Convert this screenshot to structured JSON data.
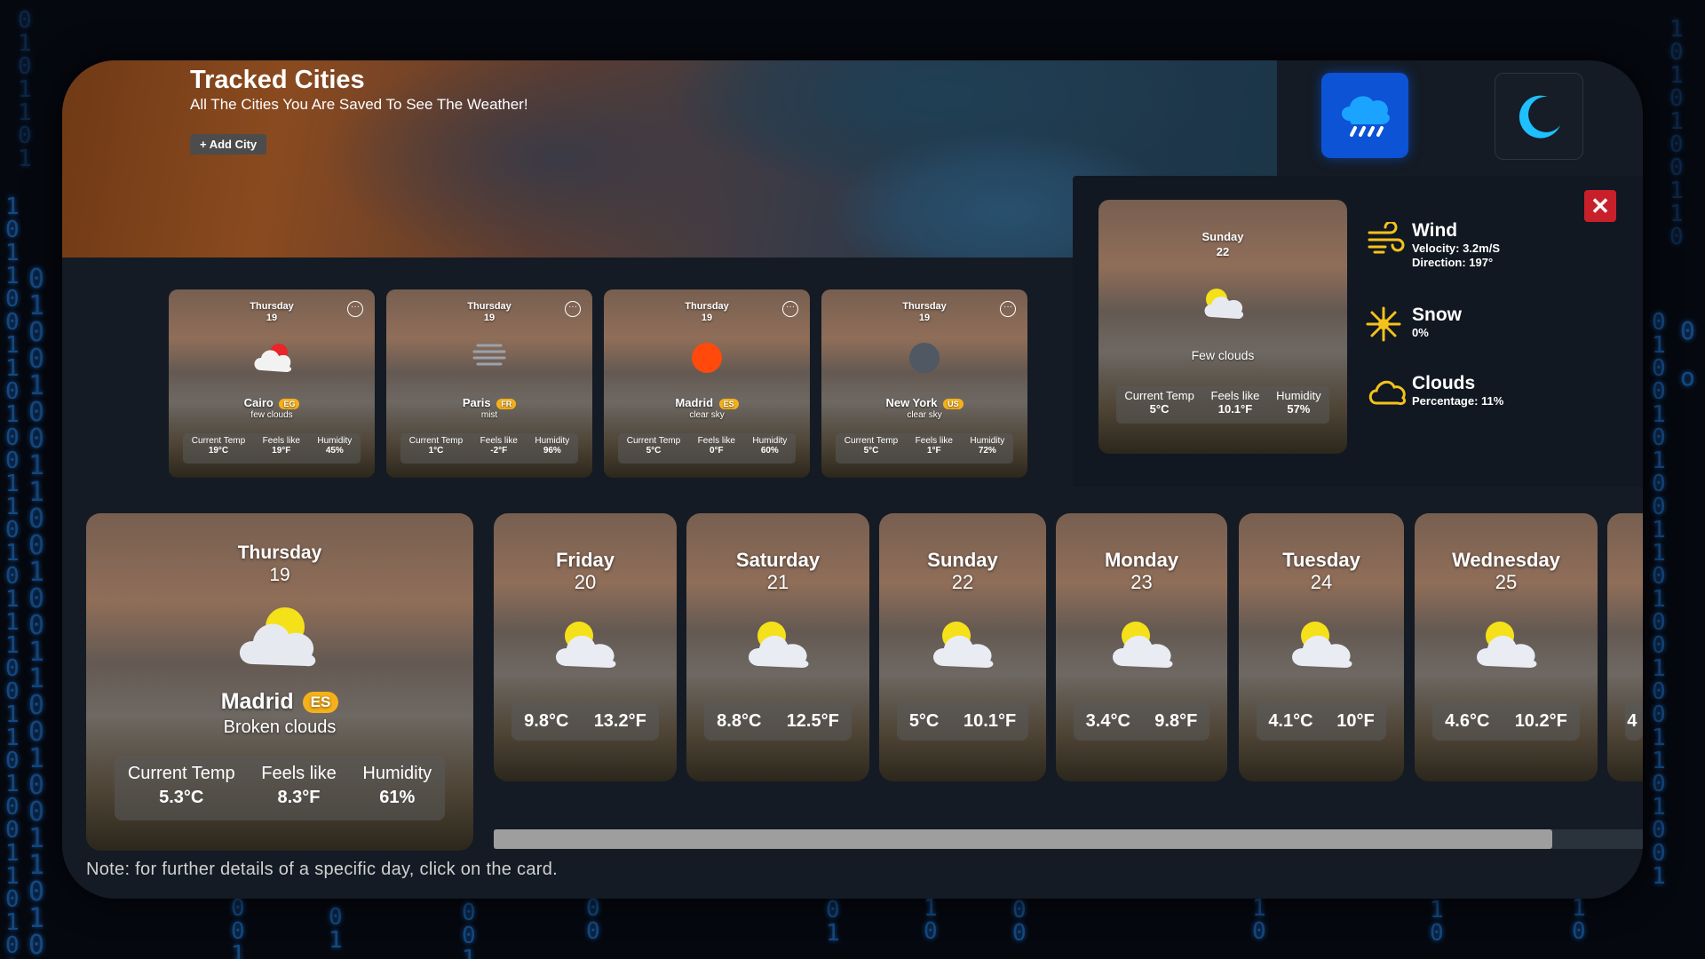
{
  "header": {
    "title": "Tracked Cities",
    "subtitle": "All The Cities You Are Saved To See The Weather!",
    "add_city_label": "+ Add City"
  },
  "top_buttons": [
    {
      "icon": "rain-cloud-icon",
      "active": true
    },
    {
      "icon": "moon-icon",
      "active": false
    }
  ],
  "tracked_cities": [
    {
      "day": "Thursday",
      "date": "19",
      "icon": "sun-cloud-icon",
      "city": "Cairo",
      "country": "EG",
      "desc": "few clouds",
      "current_temp": "19°C",
      "feels_like": "19°F",
      "humidity": "45%"
    },
    {
      "day": "Thursday",
      "date": "19",
      "icon": "mist-icon",
      "city": "Paris",
      "country": "FR",
      "desc": "mist",
      "current_temp": "1°C",
      "feels_like": "-2°F",
      "humidity": "96%"
    },
    {
      "day": "Thursday",
      "date": "19",
      "icon": "sun-icon",
      "city": "Madrid",
      "country": "ES",
      "desc": "clear sky",
      "current_temp": "5°C",
      "feels_like": "0°F",
      "humidity": "60%"
    },
    {
      "day": "Thursday",
      "date": "19",
      "icon": "moon-night-icon",
      "city": "New York",
      "country": "US",
      "desc": "clear sky",
      "current_temp": "5°C",
      "feels_like": "1°F",
      "humidity": "72%"
    }
  ],
  "stat_labels": {
    "current_temp": "Current Temp",
    "feels_like": "Feels like",
    "humidity": "Humidity"
  },
  "detail": {
    "day": "Sunday",
    "date": "22",
    "desc": "Few clouds",
    "current_temp": "5°C",
    "feels_like": "10.1°F",
    "humidity": "57%",
    "close_label": "✕",
    "wind": {
      "title": "Wind",
      "velocity": "Velocity: 3.2m/S",
      "direction": "Direction: 197°"
    },
    "snow": {
      "title": "Snow",
      "value": "0%"
    },
    "clouds": {
      "title": "Clouds",
      "value": "Percentage: 11%"
    }
  },
  "today": {
    "day": "Thursday",
    "date": "19",
    "city": "Madrid",
    "country": "ES",
    "desc": "Broken clouds",
    "current_temp": "5.3°C",
    "feels_like": "8.3°F",
    "humidity": "61%"
  },
  "forecast": [
    {
      "day": "Friday",
      "date": "20",
      "temp_c": "9.8°C",
      "temp_f": "13.2°F"
    },
    {
      "day": "Saturday",
      "date": "21",
      "temp_c": "8.8°C",
      "temp_f": "12.5°F"
    },
    {
      "day": "Sunday",
      "date": "22",
      "temp_c": "5°C",
      "temp_f": "10.1°F"
    },
    {
      "day": "Monday",
      "date": "23",
      "temp_c": "3.4°C",
      "temp_f": "9.8°F"
    },
    {
      "day": "Tuesday",
      "date": "24",
      "temp_c": "4.1°C",
      "temp_f": "10°F"
    },
    {
      "day": "Wednesday",
      "date": "25",
      "temp_c": "4.6°C",
      "temp_f": "10.2°F"
    },
    {
      "day": "",
      "date": "",
      "temp_c": "4",
      "temp_f": ""
    }
  ],
  "note": "Note: for further details of a specific day, click on the card.",
  "colors": {
    "accent": "#0d53d6",
    "badge": "#f6b11a",
    "close": "#c8202b",
    "icon_yellow": "#f5c21b"
  }
}
